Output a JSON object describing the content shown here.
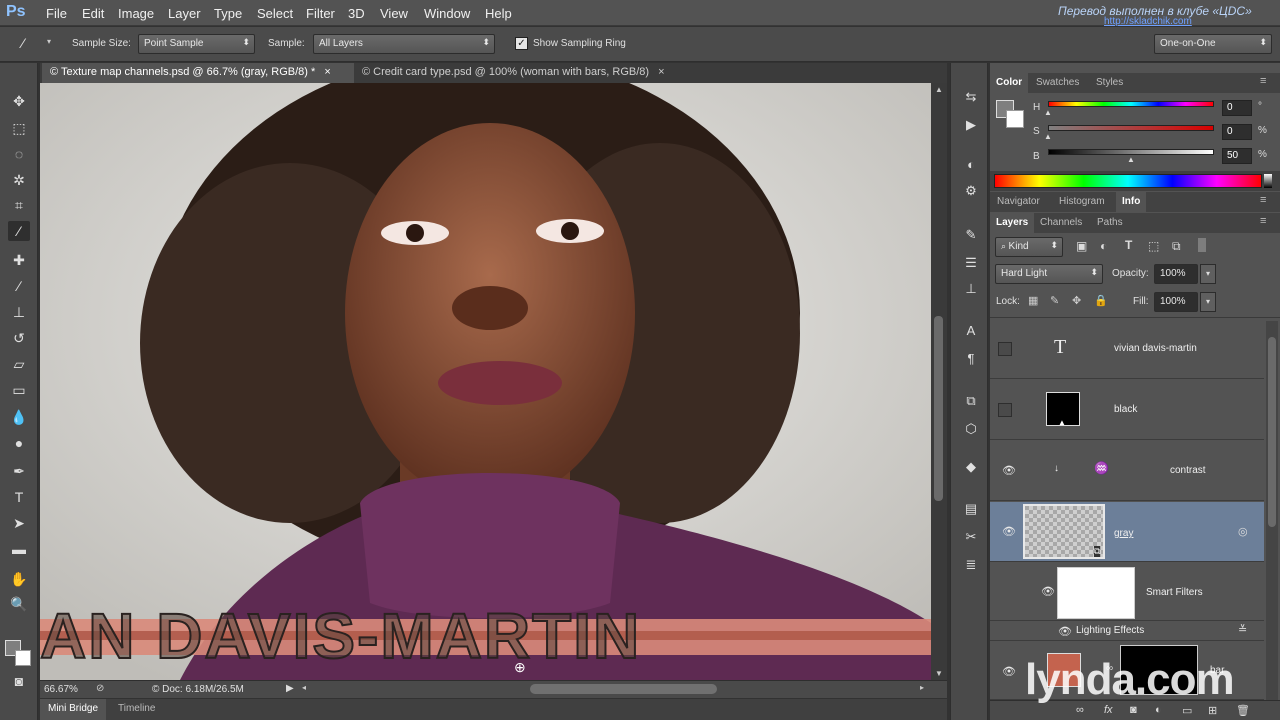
{
  "app": {
    "logo": "Ps"
  },
  "menu": [
    "File",
    "Edit",
    "Image",
    "Layer",
    "Type",
    "Select",
    "Filter",
    "3D",
    "View",
    "Window",
    "Help"
  ],
  "translator_note": {
    "line1": "Перевод выполнен в клубе «ЦDC»",
    "line2": "http://skladchik.com"
  },
  "options": {
    "sample_size_label": "Sample Size:",
    "sample_size_value": "Point Sample",
    "sample_label": "Sample:",
    "sample_value": "All Layers",
    "show_ring_label": "Show Sampling Ring",
    "workspace": "One-on-One"
  },
  "doc_tabs": [
    {
      "label": "© Texture map channels.psd @ 66.7% (gray, RGB/8) *",
      "close": "×"
    },
    {
      "label": "© Credit card type.psd @ 100% (woman with bars, RGB/8)",
      "close": "×"
    }
  ],
  "canvas": {
    "overlay_text": "AN DAVIS-MARTIN"
  },
  "status": {
    "zoom": "66.67%",
    "doc": "© Doc: 6.18M/26.5M"
  },
  "bottom_tabs": [
    "Mini Bridge",
    "Timeline"
  ],
  "color_panel": {
    "tabs": [
      "Color",
      "Swatches",
      "Styles"
    ],
    "rows": [
      {
        "label": "H",
        "value": "0",
        "unit": "°"
      },
      {
        "label": "S",
        "value": "0",
        "unit": "%"
      },
      {
        "label": "B",
        "value": "50",
        "unit": "%"
      }
    ]
  },
  "nav_panel": {
    "tabs": [
      "Navigator",
      "Histogram",
      "Info"
    ]
  },
  "layers_panel": {
    "tabs": [
      "Layers",
      "Channels",
      "Paths"
    ],
    "kind_label": "Kind",
    "blend_mode": "Hard Light",
    "opacity_label": "Opacity:",
    "opacity_value": "100%",
    "lock_label": "Lock:",
    "fill_label": "Fill:",
    "fill_value": "100%",
    "layers": [
      {
        "name": "vivian davis-martin"
      },
      {
        "name": "black"
      },
      {
        "name": "contrast"
      },
      {
        "name": "gray"
      },
      {
        "name": "Smart Filters"
      },
      {
        "name": "Lighting Effects"
      },
      {
        "name": "bar"
      }
    ]
  },
  "watermark": "lynda.com",
  "colors": {
    "accent": "#8fc3ff",
    "selected_layer": "#6c7f99",
    "bar_pink": "#d98a7a",
    "sweater": "#5e2a52"
  }
}
